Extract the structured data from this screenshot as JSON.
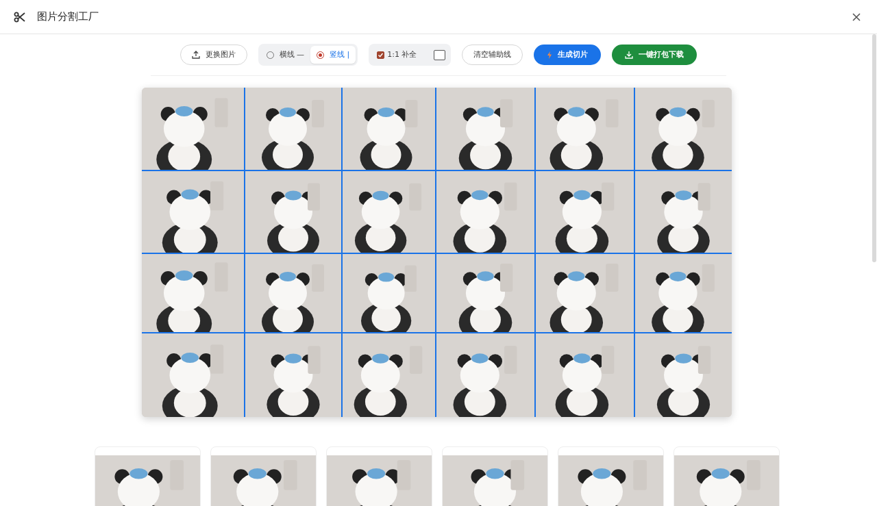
{
  "window": {
    "title": "图片分割工厂"
  },
  "toolbar": {
    "replace_button": {
      "label": "更换图片"
    },
    "guide_modes": [
      {
        "label": "横线 —",
        "selected": false
      },
      {
        "label": "竖线 |",
        "selected": true
      }
    ],
    "pad_option": {
      "label": "1:1 补全",
      "checked": true
    },
    "clear_button": {
      "label": "清空辅助线"
    },
    "generate_button": {
      "label": "生成切片"
    },
    "download_button": {
      "label": "一键打包下载"
    }
  }
}
